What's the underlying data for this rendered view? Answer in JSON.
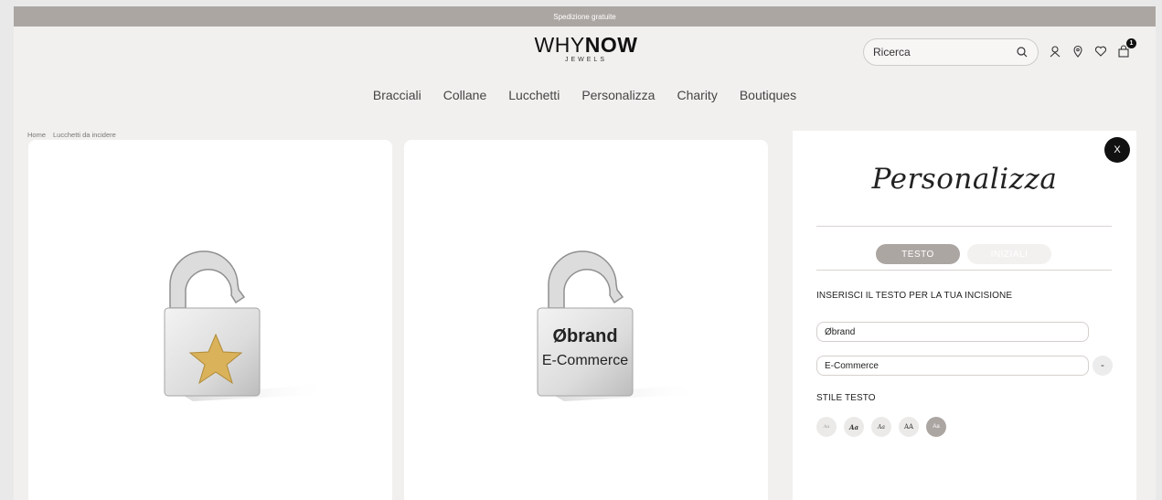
{
  "promo": {
    "text": "Spedizione gratuite"
  },
  "logo": {
    "brand_light": "WHY",
    "brand_bold": "NOW",
    "sub": "JEWELS"
  },
  "search": {
    "placeholder": "Ricerca"
  },
  "icons": {
    "search": "search-icon",
    "account": "user-icon",
    "stores": "location-pin-icon",
    "wishlist": "heart-icon",
    "cart": "shopping-bag-icon"
  },
  "cart": {
    "count": "1"
  },
  "nav": {
    "items": [
      {
        "label": "Bracciali"
      },
      {
        "label": "Collane"
      },
      {
        "label": "Lucchetti"
      },
      {
        "label": "Personalizza"
      },
      {
        "label": "Charity"
      },
      {
        "label": "Boutiques"
      }
    ]
  },
  "breadcrumb": {
    "home": "Home",
    "current": "Lucchetti da incidere"
  },
  "products": {
    "image2": {
      "engraving_line1": "Øbrand",
      "engraving_line2": "E-Commerce"
    }
  },
  "panel": {
    "close_label": "X",
    "title": "Personalizza",
    "tabs": [
      {
        "label": "TESTO",
        "active": true
      },
      {
        "label": "INIZIALI",
        "active": false
      }
    ],
    "text_label": "INSERISCI IL TESTO PER LA TUA INCISIONE",
    "line1_value": "Øbrand",
    "line2_value": "E-Commerce",
    "remove_label": "-",
    "style_label": "STILE TESTO",
    "style_options": [
      {
        "label": "Aa",
        "active": false
      },
      {
        "label": "Aa",
        "active": false
      },
      {
        "label": "Aa",
        "active": false
      },
      {
        "label": "AA",
        "active": false
      },
      {
        "label": "Aa",
        "active": true
      }
    ]
  },
  "colors": {
    "promo_bar": "#aca6a3",
    "page_bg": "#f2f0ef",
    "accent": "#aca6a3",
    "star_gold": "#d9b25a"
  }
}
